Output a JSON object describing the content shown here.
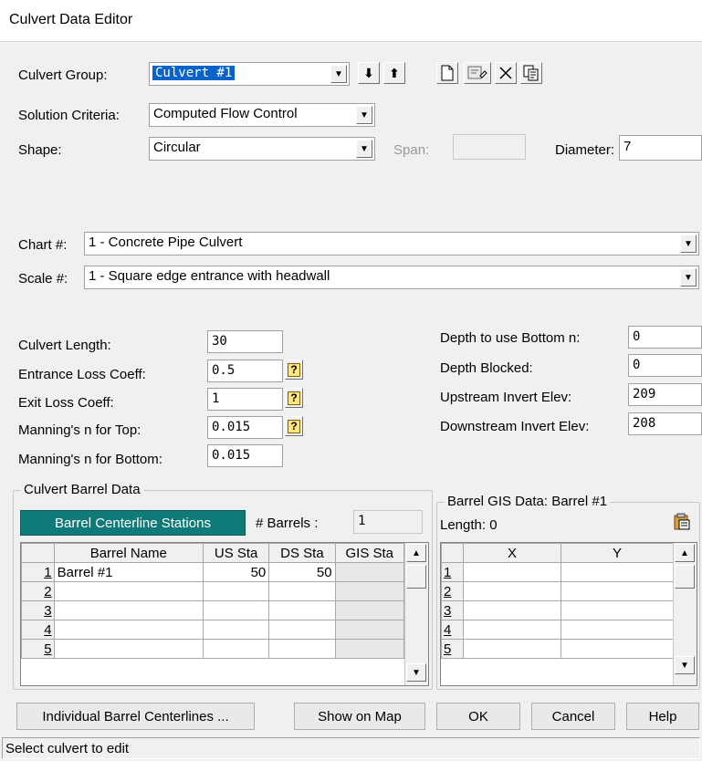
{
  "window": {
    "title": "Culvert Data Editor"
  },
  "culvert_group": {
    "label": "Culvert Group:",
    "value": "Culvert #1"
  },
  "toolbar": {
    "down_arrow": "⬇",
    "up_arrow": "⬆"
  },
  "solution_criteria": {
    "label": "Solution Criteria:",
    "value": "Computed Flow Control"
  },
  "shape": {
    "label": "Shape:",
    "value": "Circular"
  },
  "span": {
    "label": "Span:",
    "value": ""
  },
  "diameter": {
    "label": "Diameter:",
    "value": "7"
  },
  "chart": {
    "label": "Chart #:",
    "value": "1 - Concrete Pipe Culvert"
  },
  "scale": {
    "label": "Scale #:",
    "value": "1 - Square edge entrance with headwall"
  },
  "left_fields": {
    "culvert_length": {
      "label": "Culvert Length:",
      "value": "30"
    },
    "entrance_loss": {
      "label": "Entrance Loss Coeff:",
      "value": "0.5"
    },
    "exit_loss": {
      "label": "Exit Loss Coeff:",
      "value": "1"
    },
    "manning_top": {
      "label": "Manning's n for Top:",
      "value": "0.015"
    },
    "manning_bottom": {
      "label": "Manning's n for Bottom:",
      "value": "0.015"
    }
  },
  "right_fields": {
    "depth_bottom_n": {
      "label": "Depth to use Bottom n:",
      "value": "0"
    },
    "depth_blocked": {
      "label": "Depth Blocked:",
      "value": "0"
    },
    "upstream_invert": {
      "label": "Upstream Invert Elev:",
      "value": "209"
    },
    "downstream_invert": {
      "label": "Downstream Invert Elev:",
      "value": "208"
    }
  },
  "help_button_glyph": "?",
  "barrel_data": {
    "legend": "Culvert Barrel Data",
    "centerline_button": "Barrel Centerline Stations",
    "barrels_label": "# Barrels :",
    "barrels_value": "1",
    "columns": [
      "Barrel Name",
      "US Sta",
      "DS Sta",
      "GIS Sta"
    ],
    "rows": [
      {
        "n": "1",
        "name": "Barrel #1",
        "us": "50",
        "ds": "50",
        "gis": ""
      },
      {
        "n": "2",
        "name": "",
        "us": "",
        "ds": "",
        "gis": ""
      },
      {
        "n": "3",
        "name": "",
        "us": "",
        "ds": "",
        "gis": ""
      },
      {
        "n": "4",
        "name": "",
        "us": "",
        "ds": "",
        "gis": ""
      },
      {
        "n": "5",
        "name": "",
        "us": "",
        "ds": "",
        "gis": ""
      }
    ]
  },
  "gis_data": {
    "legend": "Barrel GIS Data: Barrel #1",
    "length_label": "Length: 0",
    "columns": [
      "X",
      "Y"
    ],
    "rows": [
      "1",
      "2",
      "3",
      "4",
      "5"
    ]
  },
  "buttons": {
    "individual": "Individual Barrel Centerlines ...",
    "show_map": "Show on Map",
    "ok": "OK",
    "cancel": "Cancel",
    "help": "Help"
  },
  "status": "Select culvert to edit"
}
